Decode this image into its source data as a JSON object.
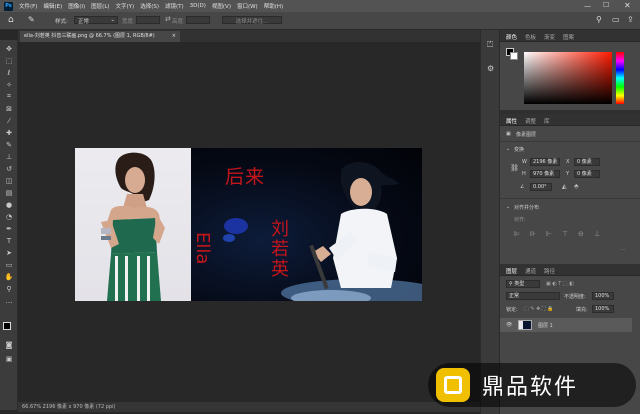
{
  "menu": {
    "logo": "Ps",
    "items": [
      "文件(F)",
      "编辑(E)",
      "图像(I)",
      "图层(L)",
      "文字(Y)",
      "选择(S)",
      "滤镜(T)",
      "3D(D)",
      "视图(V)",
      "窗口(W)",
      "帮助(H)"
    ]
  },
  "options": {
    "style_label": "样式:",
    "style_value": "正常",
    "width_label": "宽度:",
    "height_label": "高度:",
    "button_label": "选择并遮住..."
  },
  "document": {
    "tab_title": "ella-刘若英 抖音三联画.png @ 66.7% (图层 1, RGB/8#)",
    "status": "66.67%    2196 像素 x 970 像素 (72 ppi)"
  },
  "canvas_text": {
    "houlai": "后来",
    "ella": "Ella",
    "name": "刘若英"
  },
  "color_panel": {
    "tabs": [
      "颜色",
      "色板",
      "渐变",
      "图案"
    ]
  },
  "properties_panel": {
    "tabs": [
      "属性",
      "调整",
      "库"
    ],
    "layer_kind": "像素图层",
    "transform_header": "变换",
    "w_label": "W",
    "w_value": "2196 像素",
    "x_label": "X",
    "x_value": "0 像素",
    "h_label": "H",
    "h_value": "970 像素",
    "y_label": "Y",
    "y_value": "0 像素",
    "angle_value": "0.00°",
    "align_header": "对齐并分布",
    "align_label": "对齐:"
  },
  "layers_panel": {
    "tabs": [
      "图层",
      "通道",
      "路径"
    ],
    "filter_label": "类型",
    "blend_mode": "正常",
    "opacity_label": "不透明度:",
    "opacity_value": "100%",
    "lock_label": "锁定:",
    "fill_label": "填充:",
    "fill_value": "100%",
    "layer_name": "图层 1"
  },
  "watermark": {
    "text": "鼎品软件"
  },
  "colors": {
    "accent_red": "#c4151b",
    "ui_dark": "#282828",
    "ui_panel": "#474747"
  }
}
